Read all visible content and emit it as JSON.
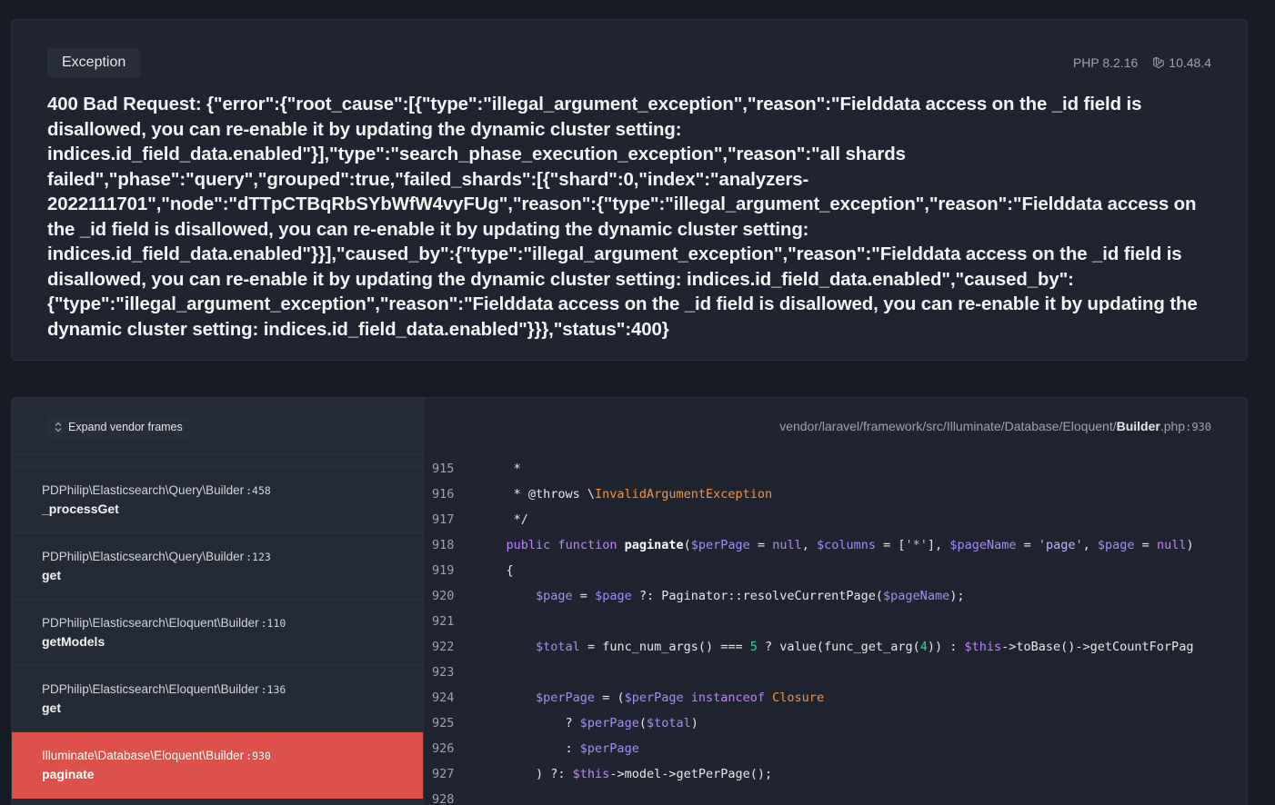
{
  "exception": {
    "badge": "Exception",
    "php_version": "PHP 8.2.16",
    "laravel_version": "10.48.4",
    "message": "400 Bad Request: {\"error\":{\"root_cause\":[{\"type\":\"illegal_argument_exception\",\"reason\":\"Fielddata access on the _id field is disallowed, you can re-enable it by updating the dynamic cluster setting: indices.id_field_data.enabled\"}],\"type\":\"search_phase_execution_exception\",\"reason\":\"all shards failed\",\"phase\":\"query\",\"grouped\":true,\"failed_shards\":[{\"shard\":0,\"index\":\"analyzers-2022111701\",\"node\":\"dTTpCTBqRbSYbWfW4vyFUg\",\"reason\":{\"type\":\"illegal_argument_exception\",\"reason\":\"Fielddata access on the _id field is disallowed, you can re-enable it by updating the dynamic cluster setting: indices.id_field_data.enabled\"}}],\"caused_by\":{\"type\":\"illegal_argument_exception\",\"reason\":\"Fielddata access on the _id field is disallowed, you can re-enable it by updating the dynamic cluster setting: indices.id_field_data.enabled\",\"caused_by\":{\"type\":\"illegal_argument_exception\",\"reason\":\"Fielddata access on the _id field is disallowed, you can re-enable it by updating the dynamic cluster setting: indices.id_field_data.enabled\"}}},\"status\":400}"
  },
  "frames_panel": {
    "expand_label": "Expand vendor frames",
    "frames": [
      {
        "class": "PDPhilip\\Elasticsearch\\Query\\Builder",
        "line": ":458",
        "method": "_processGet",
        "active": false
      },
      {
        "class": "PDPhilip\\Elasticsearch\\Query\\Builder",
        "line": ":123",
        "method": "get",
        "active": false
      },
      {
        "class": "PDPhilip\\Elasticsearch\\Eloquent\\Builder",
        "line": ":110",
        "method": "getModels",
        "active": false
      },
      {
        "class": "PDPhilip\\Elasticsearch\\Eloquent\\Builder",
        "line": ":136",
        "method": "get",
        "active": false
      },
      {
        "class": "Illuminate\\Database\\Eloquent\\Builder",
        "line": ":930",
        "method": "paginate",
        "active": true
      }
    ]
  },
  "code_panel": {
    "path_prefix": "vendor/laravel/framework/src/Illuminate/Database/Eloquent/",
    "file_name": "Builder",
    "file_ext": ".php",
    "line_ref": ":930",
    "line_numbers": [
      "915",
      "916",
      "917",
      "918",
      "919",
      "920",
      "921",
      "922",
      "923",
      "924",
      "925",
      "926",
      "927",
      "928"
    ]
  },
  "colors": {
    "background": "#151a24",
    "card": "#1f2430",
    "frames_bg": "#242a36",
    "active_frame": "#dc524a"
  }
}
